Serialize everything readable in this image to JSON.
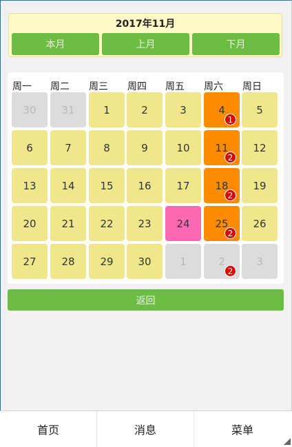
{
  "header": {
    "month_title": "2017年11月",
    "buttons": {
      "this_month": "本月",
      "prev_month": "上月",
      "next_month": "下月"
    }
  },
  "calendar": {
    "weekdays": [
      "周一",
      "周二",
      "周三",
      "周四",
      "周五",
      "周六",
      "周日"
    ],
    "days": [
      {
        "label": "30",
        "state": "other"
      },
      {
        "label": "31",
        "state": "other"
      },
      {
        "label": "1",
        "state": "current"
      },
      {
        "label": "2",
        "state": "current"
      },
      {
        "label": "3",
        "state": "current"
      },
      {
        "label": "4",
        "state": "marked",
        "badge": "1"
      },
      {
        "label": "5",
        "state": "current"
      },
      {
        "label": "6",
        "state": "current"
      },
      {
        "label": "7",
        "state": "current"
      },
      {
        "label": "8",
        "state": "current"
      },
      {
        "label": "9",
        "state": "current"
      },
      {
        "label": "10",
        "state": "current"
      },
      {
        "label": "11",
        "state": "marked",
        "badge": "2"
      },
      {
        "label": "12",
        "state": "current"
      },
      {
        "label": "13",
        "state": "current"
      },
      {
        "label": "14",
        "state": "current"
      },
      {
        "label": "15",
        "state": "current"
      },
      {
        "label": "16",
        "state": "current"
      },
      {
        "label": "17",
        "state": "current"
      },
      {
        "label": "18",
        "state": "marked",
        "badge": "2"
      },
      {
        "label": "19",
        "state": "current"
      },
      {
        "label": "20",
        "state": "current"
      },
      {
        "label": "21",
        "state": "current"
      },
      {
        "label": "22",
        "state": "current"
      },
      {
        "label": "23",
        "state": "current"
      },
      {
        "label": "24",
        "state": "today"
      },
      {
        "label": "25",
        "state": "marked",
        "badge": "2"
      },
      {
        "label": "26",
        "state": "current"
      },
      {
        "label": "27",
        "state": "current"
      },
      {
        "label": "28",
        "state": "current"
      },
      {
        "label": "29",
        "state": "current"
      },
      {
        "label": "30",
        "state": "current"
      },
      {
        "label": "1",
        "state": "other"
      },
      {
        "label": "2",
        "state": "other",
        "badge": "2"
      },
      {
        "label": "3",
        "state": "other"
      }
    ]
  },
  "back_button": "返回",
  "tabbar": {
    "home": "首页",
    "messages": "消息",
    "menu": "菜单"
  },
  "colors": {
    "green": "#6dbd45",
    "cell": "#f0e68c",
    "other": "#dcdcdc",
    "marked": "#ff8c00",
    "today": "#ff69b4",
    "badge": "#e00000"
  }
}
